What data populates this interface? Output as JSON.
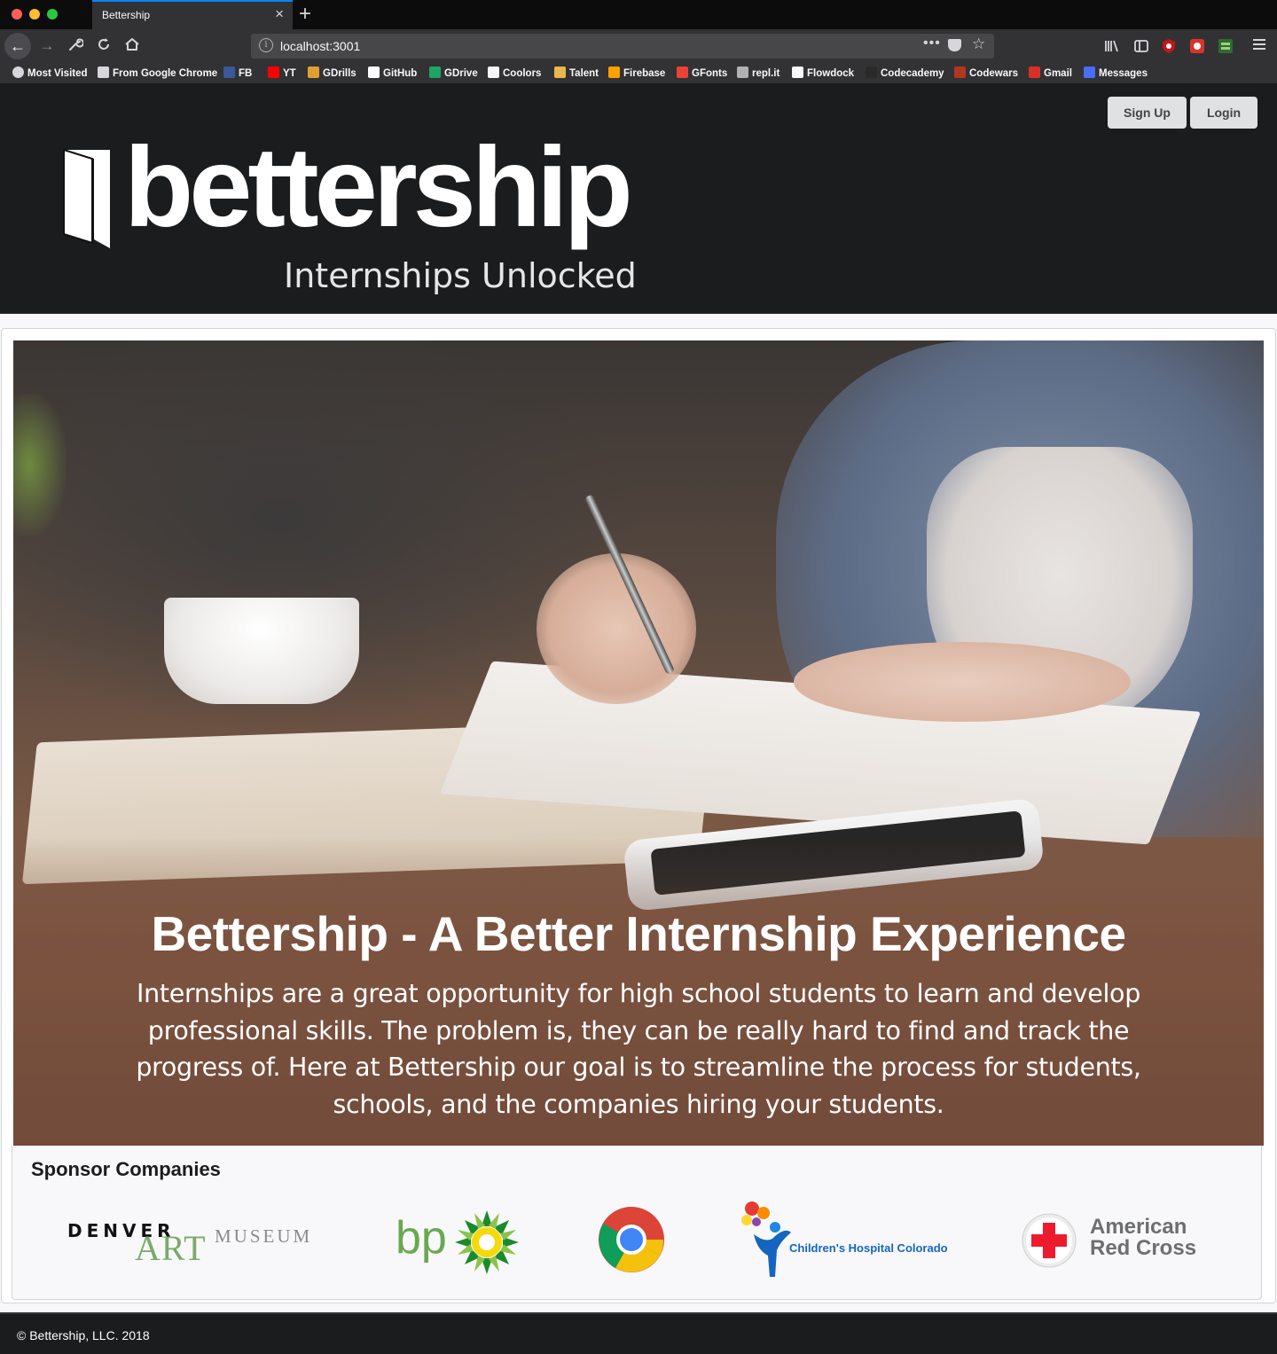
{
  "browser": {
    "tab_title": "Bettership",
    "tab_close": "×",
    "new_tab": "+",
    "url": "localhost:3001",
    "url_actions": "•••",
    "bookmarks": [
      {
        "label": "Most Visited",
        "color": "#d7d7db",
        "icon": "gear-icon"
      },
      {
        "label": "From Google Chrome",
        "color": "#d7d7db",
        "icon": "folder-icon"
      },
      {
        "label": "FB",
        "color": "#3b5998",
        "icon": "facebook-icon"
      },
      {
        "label": "YT",
        "color": "#ff0000",
        "icon": "youtube-icon"
      },
      {
        "label": "GDrills",
        "color": "#e0a030",
        "icon": "gdrills-icon"
      },
      {
        "label": "GitHub",
        "color": "#ffffff",
        "icon": "github-icon"
      },
      {
        "label": "GDrive",
        "color": "#1fa463",
        "icon": "gdrive-icon"
      },
      {
        "label": "Coolors",
        "color": "#f7f7f7",
        "icon": "coolors-icon"
      },
      {
        "label": "Talent",
        "color": "#e8b84a",
        "icon": "talent-icon"
      },
      {
        "label": "Firebase",
        "color": "#ffa000",
        "icon": "firebase-icon"
      },
      {
        "label": "GFonts",
        "color": "#ea4335",
        "icon": "gfonts-icon"
      },
      {
        "label": "repl.it",
        "color": "#b0b0b0",
        "icon": "replit-icon"
      },
      {
        "label": "Flowdock",
        "color": "#f9f9fa",
        "icon": "flowdock-icon"
      },
      {
        "label": "Codecademy",
        "color": "#2a2a2a",
        "icon": "codecademy-icon"
      },
      {
        "label": "Codewars",
        "color": "#b1361e",
        "icon": "codewars-icon"
      },
      {
        "label": "Gmail",
        "color": "#d93025",
        "icon": "gmail-icon"
      },
      {
        "label": "Messages",
        "color": "#4a6cf7",
        "icon": "messages-icon"
      }
    ]
  },
  "header": {
    "logo_text": "bettership",
    "tagline": "Internships Unlocked",
    "signup_label": "Sign Up",
    "login_label": "Login"
  },
  "hero": {
    "title": "Bettership - A Better Internship Experience",
    "text": "Internships are a great opportunity for high school students to learn and develop professional skills. The problem is, they can be really hard to find and track the progress of. Here at Bettership our goal is to streamline the process for students, schools, and the companies hiring your students."
  },
  "sponsors": {
    "title": "Sponsor Companies",
    "logos": [
      {
        "name": "Denver Art Museum",
        "line1": "DENVER",
        "line2": "ART",
        "line3": "MUSEUM"
      },
      {
        "name": "BP",
        "text": "bp",
        "color": "#6aa84f"
      },
      {
        "name": "Google Chrome"
      },
      {
        "name": "Children's Hospital Colorado",
        "text": "Children's Hospital Colorado"
      },
      {
        "name": "American Red Cross",
        "line1": "American",
        "line2": "Red Cross",
        "color": "#ed1b2e"
      }
    ]
  },
  "footer": {
    "copyright": "© Bettership, LLC. 2018"
  }
}
